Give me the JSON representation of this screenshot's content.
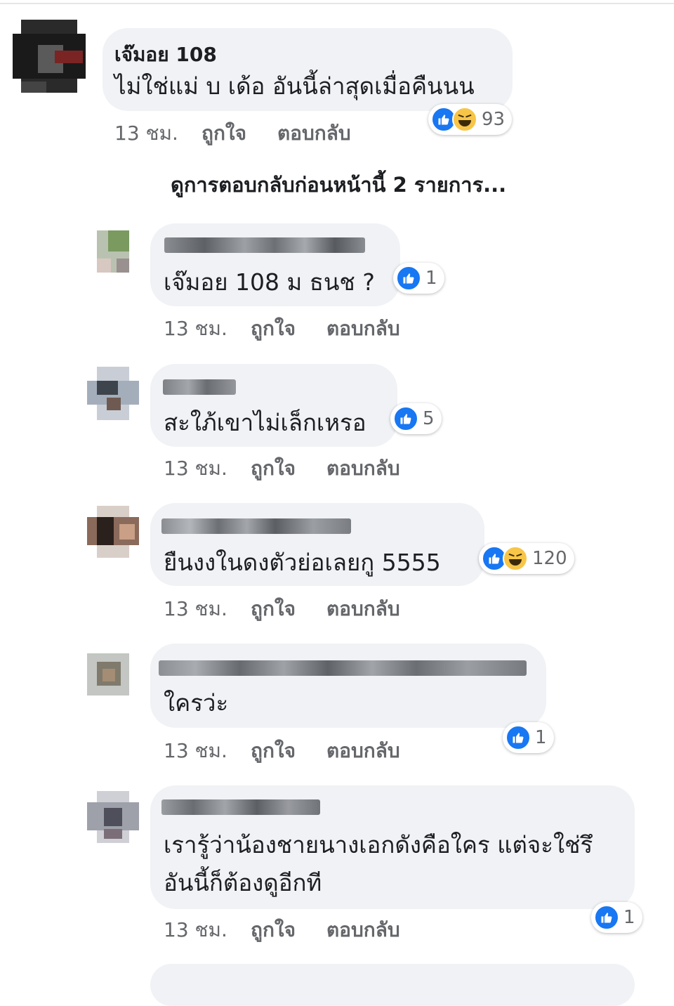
{
  "view_previous_replies": "ดูการตอบกลับก่อนหน้านี้ 2 รายการ...",
  "actions": {
    "like": "ถูกใจ",
    "reply": "ตอบกลับ"
  },
  "comments": [
    {
      "author": "เจ๊มอย 108",
      "text": "ไม่ใช่แม่ บ เด้อ อันนี้ล่าสุดเมื่อคืนนน",
      "time": "13 ชม.",
      "reactions": [
        "like",
        "haha"
      ],
      "reaction_count": "93"
    },
    {
      "author": "",
      "text": "เจ๊มอย 108 ม ธนช ?",
      "time": "13 ชม.",
      "reactions": [
        "like"
      ],
      "reaction_count": "1"
    },
    {
      "author": "",
      "text": "สะใภ้เขาไม่เล็กเหรอ",
      "time": "13 ชม.",
      "reactions": [
        "like"
      ],
      "reaction_count": "5"
    },
    {
      "author": "",
      "text": "ยืนงงในดงตัวย่อเลยกู 5555",
      "time": "13 ชม.",
      "reactions": [
        "like",
        "haha"
      ],
      "reaction_count": "120"
    },
    {
      "author": "",
      "text": "ใครว่ะ",
      "time": "13 ชม.",
      "reactions": [
        "like"
      ],
      "reaction_count": "1"
    },
    {
      "author": "",
      "text": "เรารู้ว่าน้องชายนางเอกดังคือใคร แต่จะใช่รึอันนี้ก็ต้องดูอีกที",
      "time": "13 ชม.",
      "reactions": [
        "like"
      ],
      "reaction_count": "1"
    }
  ],
  "colors": {
    "bubble": "#f0f2f5",
    "like": "#1877f2",
    "haha": "#f7c548",
    "meta": "#65676b"
  }
}
